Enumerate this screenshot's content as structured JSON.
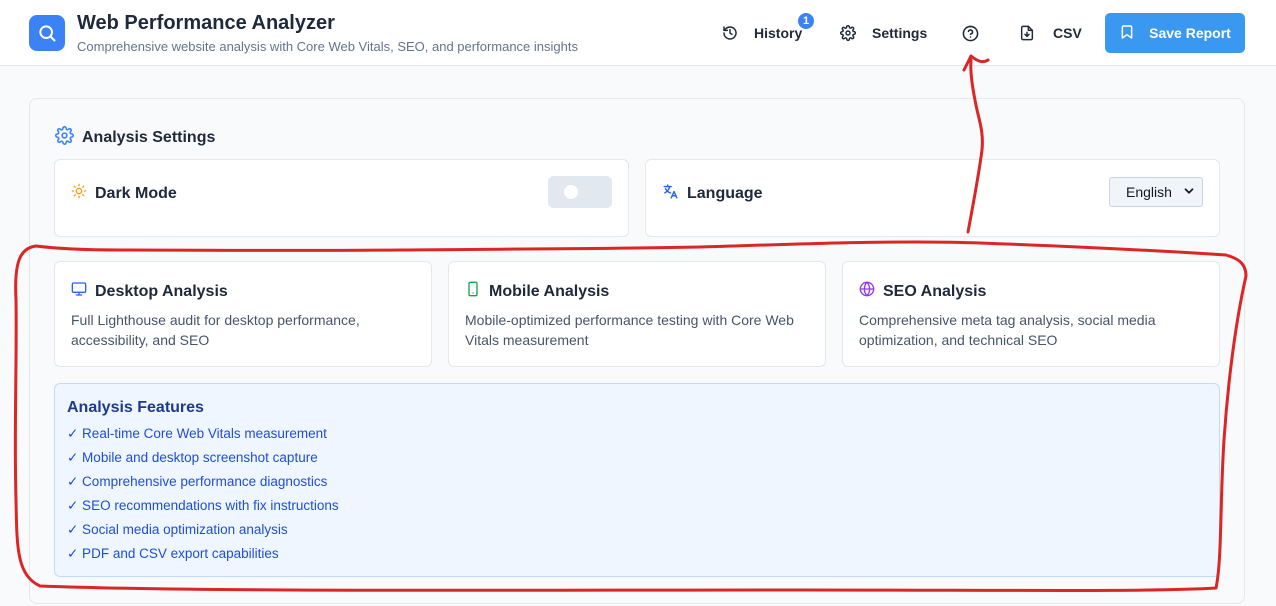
{
  "header": {
    "title": "Web Performance Analyzer",
    "subtitle": "Comprehensive website analysis with Core Web Vitals, SEO, and performance insights",
    "history_label": "History",
    "history_badge": "1",
    "settings_label": "Settings",
    "csv_label": "CSV",
    "save_report_label": "Save Report"
  },
  "settings": {
    "title": "Analysis Settings",
    "dark_mode_label": "Dark Mode",
    "dark_mode_on": false,
    "language_label": "Language",
    "language_value": "English"
  },
  "analysis_types": [
    {
      "title": "Desktop Analysis",
      "description": "Full Lighthouse audit for desktop performance, accessibility, and SEO",
      "icon": "monitor-icon"
    },
    {
      "title": "Mobile Analysis",
      "description": "Mobile-optimized performance testing with Core Web Vitals measurement",
      "icon": "smartphone-icon"
    },
    {
      "title": "SEO Analysis",
      "description": "Comprehensive meta tag analysis, social media optimization, and technical SEO",
      "icon": "globe-icon"
    }
  ],
  "features": {
    "title": "Analysis Features",
    "items": [
      "✓ Real-time Core Web Vitals measurement",
      "✓ Mobile and desktop screenshot capture",
      "✓ Comprehensive performance diagnostics",
      "✓ SEO recommendations with fix instructions",
      "✓ Social media optimization analysis",
      "✓ PDF and CSV export capabilities"
    ]
  },
  "colors": {
    "accent": "#3b82f6",
    "annotation": "#dc2626",
    "desktop_icon": "#2563eb",
    "mobile_icon": "#16a34a",
    "seo_icon": "#9333ea",
    "sun_icon": "#f59e0b"
  }
}
